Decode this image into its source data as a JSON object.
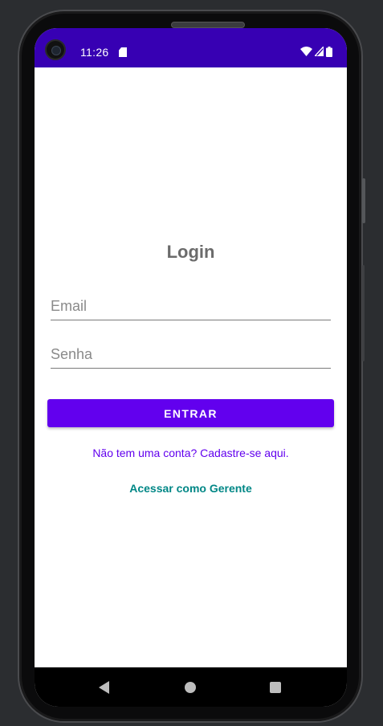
{
  "status_bar": {
    "time": "11:26",
    "background_color": "#3700b3",
    "icons": [
      "sd-card-icon",
      "wifi-icon",
      "signal-icon",
      "battery-icon"
    ]
  },
  "login": {
    "title": "Login",
    "email_placeholder": "Email",
    "email_value": "",
    "password_placeholder": "Senha",
    "password_value": "",
    "enter_label": "ENTRAR",
    "signup_link": "Não tem uma conta? Cadastre-se aqui.",
    "manager_link": "Acessar como Gerente"
  },
  "colors": {
    "primary": "#6200ee",
    "primary_dark": "#3700b3",
    "secondary": "#018786",
    "title_text": "#6b6b6b"
  },
  "nav_bar": {
    "icons": [
      "back-icon",
      "home-icon",
      "recents-icon"
    ]
  }
}
